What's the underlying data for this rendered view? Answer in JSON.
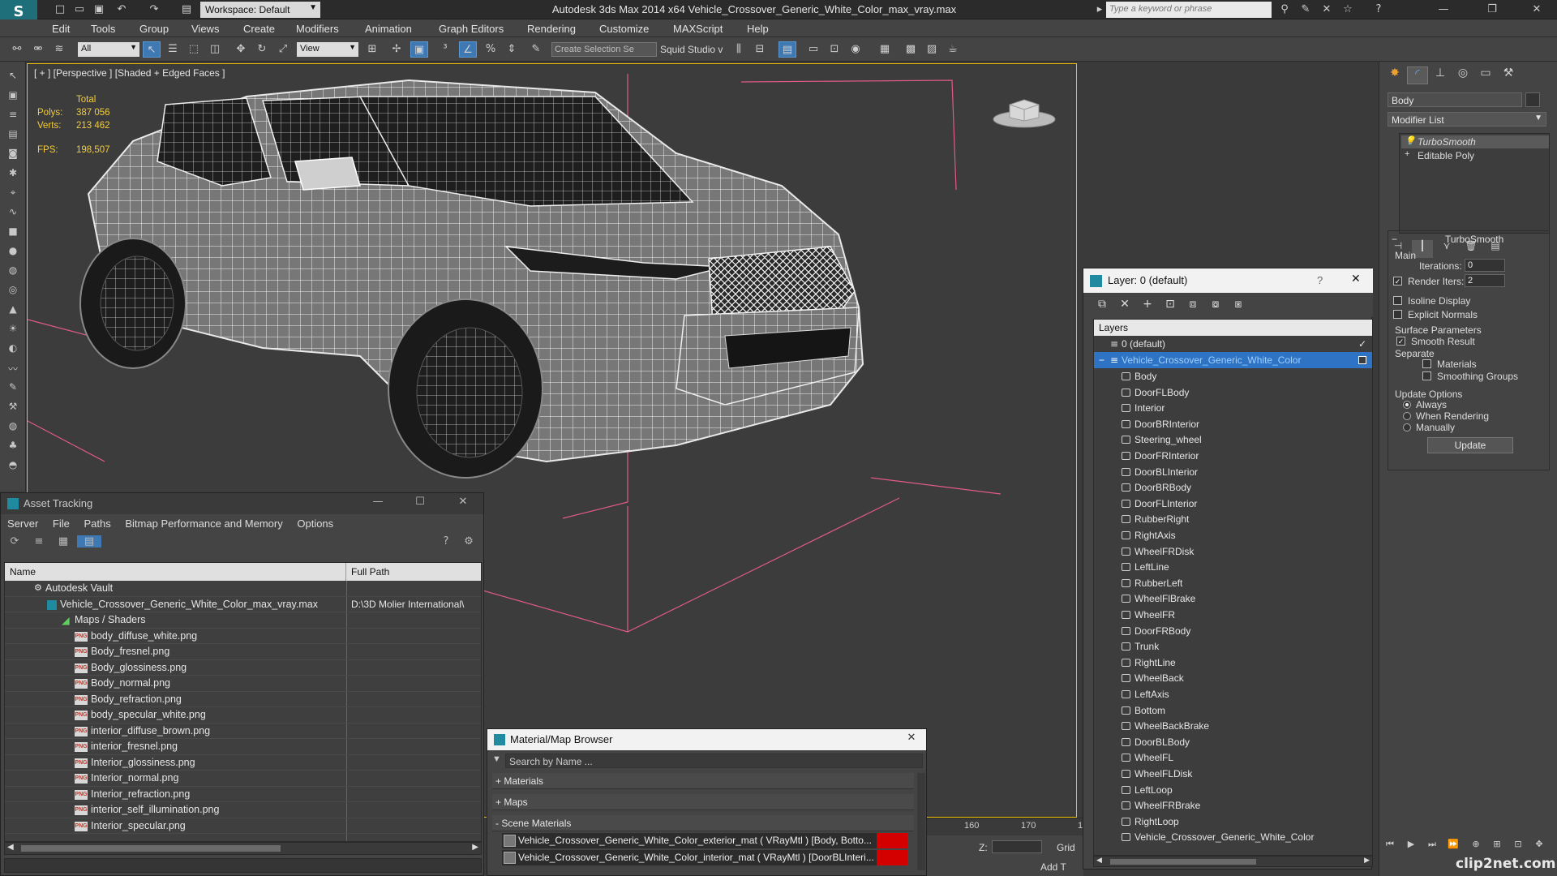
{
  "titlebar": {
    "workspace": "Workspace: Default",
    "title": "Autodesk 3ds Max  2014 x64     Vehicle_Crossover_Generic_White_Color_max_vray.max",
    "search_placeholder": "Type a keyword or phrase"
  },
  "menu": [
    "Edit",
    "Tools",
    "Group",
    "Views",
    "Create",
    "Modifiers",
    "Animation",
    "Graph Editors",
    "Rendering",
    "Customize",
    "MAXScript",
    "Help"
  ],
  "toolbar": {
    "filter": "All",
    "refcoord": "View",
    "selection_set_placeholder": "Create Selection Se",
    "squid": "Squid Studio v"
  },
  "viewport": {
    "label": "[ + ] [Perspective ] [Shaded + Edged Faces ]",
    "stats_total": "Total",
    "polys_label": "Polys:",
    "polys_value": "387 056",
    "verts_label": "Verts:",
    "verts_value": "213 462",
    "fps_label": "FPS:",
    "fps_value": "198,507"
  },
  "asset_tracking": {
    "title": "Asset Tracking",
    "menu": [
      "Server",
      "File",
      "Paths",
      "Bitmap Performance and Memory",
      "Options"
    ],
    "columns": [
      "Name",
      "Full Path"
    ],
    "vault": "Autodesk Vault",
    "file": "Vehicle_Crossover_Generic_White_Color_max_vray.max",
    "file_path": "D:\\3D Molier International\\",
    "maps_folder": "Maps / Shaders",
    "maps": [
      "body_diffuse_white.png",
      "Body_fresnel.png",
      "Body_glossiness.png",
      "Body_normal.png",
      "Body_refraction.png",
      "body_specular_white.png",
      "interior_diffuse_brown.png",
      "interior_fresnel.png",
      "Interior_glossiness.png",
      "Interior_normal.png",
      "Interior_refraction.png",
      "interior_self_illumination.png",
      "Interior_specular.png"
    ],
    "png_tag": "PNG"
  },
  "material_browser": {
    "title": "Material/Map Browser",
    "search_placeholder": "Search by Name ...",
    "categories": [
      "+ Materials",
      "+ Maps",
      "- Scene Materials"
    ],
    "items": [
      "Vehicle_Crossover_Generic_White_Color_exterior_mat ( VRayMtl ) [Body, Botto...",
      "Vehicle_Crossover_Generic_White_Color_interior_mat ( VRayMtl ) [DoorBLInteri..."
    ]
  },
  "timeline": {
    "ticks": [
      "160",
      "170",
      "1"
    ],
    "z_label": "Z:",
    "grid_label": "Grid",
    "add_label": "Add T"
  },
  "layers": {
    "title": "Layer: 0 (default)",
    "help": "?",
    "header": "Layers",
    "default_layer": "0 (default)",
    "selected_layer": "Vehicle_Crossover_Generic_White_Color",
    "objects": [
      "Body",
      "DoorFLBody",
      "Interior",
      "DoorBRInterior",
      "Steering_wheel",
      "DoorFRInterior",
      "DoorBLInterior",
      "DoorBRBody",
      "DoorFLInterior",
      "RubberRight",
      "RightAxis",
      "WheelFRDisk",
      "LeftLine",
      "RubberLeft",
      "WheelFlBrake",
      "WheelFR",
      "DoorFRBody",
      "Trunk",
      "RightLine",
      "WheelBack",
      "LeftAxis",
      "Bottom",
      "WheelBackBrake",
      "DoorBLBody",
      "WheelFL",
      "WheelFLDisk",
      "LeftLoop",
      "WheelFRBrake",
      "RightLoop",
      "Vehicle_Crossover_Generic_White_Color"
    ]
  },
  "command_panel": {
    "object_name": "Body",
    "modifier_list": "Modifier List",
    "stack": [
      "TurboSmooth",
      "Editable Poly"
    ],
    "rollout_title": "TurboSmooth",
    "main_label": "Main",
    "iterations_label": "Iterations:",
    "iterations_value": "0",
    "render_iters_label": "Render Iters:",
    "render_iters_value": "2",
    "isoline": "Isoline Display",
    "explicit_normals": "Explicit Normals",
    "surface_params": "Surface Parameters",
    "smooth_result": "Smooth Result",
    "separate": "Separate",
    "materials": "Materials",
    "smoothing_groups": "Smoothing Groups",
    "update_options": "Update Options",
    "always": "Always",
    "when_rendering": "When Rendering",
    "manually": "Manually",
    "update_button": "Update"
  },
  "watermark": "clip2net.com",
  "colors": {
    "selection_blue": "#2f73c5",
    "viewport_border": "#f0c000",
    "stats_yellow": "#f3cc3a",
    "material_red": "#d40000"
  }
}
